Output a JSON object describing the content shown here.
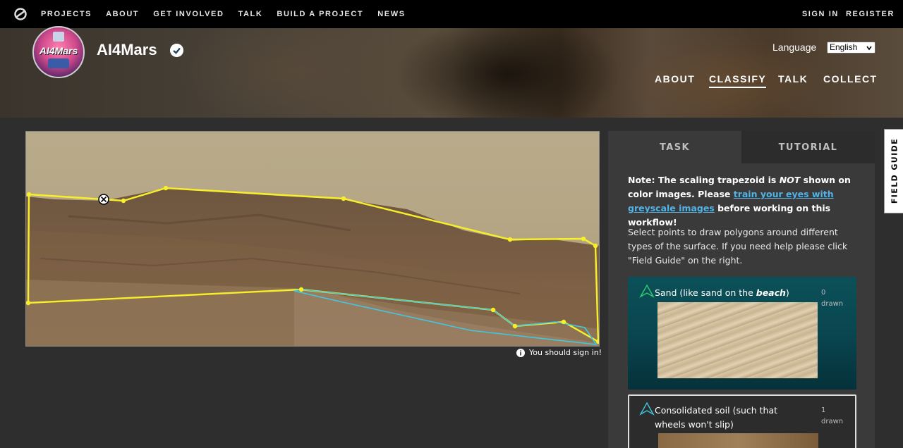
{
  "topnav": {
    "links": [
      "PROJECTS",
      "ABOUT",
      "GET INVOLVED",
      "TALK",
      "BUILD A PROJECT",
      "NEWS"
    ],
    "sign_in": "SIGN IN",
    "register": "REGISTER"
  },
  "project": {
    "avatar_text": "AI4Mars",
    "title": "AI4Mars",
    "language_label": "Language",
    "language_value": "English",
    "nav": [
      "ABOUT",
      "CLASSIFY",
      "TALK",
      "COLLECT"
    ],
    "active_nav": "CLASSIFY"
  },
  "subject": {
    "sign_in_note": "You should sign in!"
  },
  "task": {
    "tabs": [
      "TASK",
      "TUTORIAL"
    ],
    "note_prefix": "Note: The scaling trapezoid is ",
    "note_not": "NOT",
    "note_middle": " shown on color images. Please ",
    "note_link": "train your eyes with greyscale images",
    "note_suffix": " before working on this workflow!",
    "instructions": "Select points to draw polygons around different types of the surface. If you need help please click \"Field Guide\" on the right.",
    "answers": [
      {
        "label_prefix": "Sand (like sand on the ",
        "label_em": "beach",
        "label_suffix": ")",
        "count": "0",
        "count_label": "drawn",
        "color": "#2ecc71"
      },
      {
        "label": "Consolidated soil (such that wheels won't slip)",
        "count": "1",
        "count_label": "drawn",
        "color": "#3fc8e0"
      }
    ]
  },
  "field_guide": {
    "label": "FIELD GUIDE"
  },
  "colors": {
    "sand_outline": "#f7ef2a",
    "soil_outline": "#3fc8e0",
    "link": "#52b3e6"
  }
}
